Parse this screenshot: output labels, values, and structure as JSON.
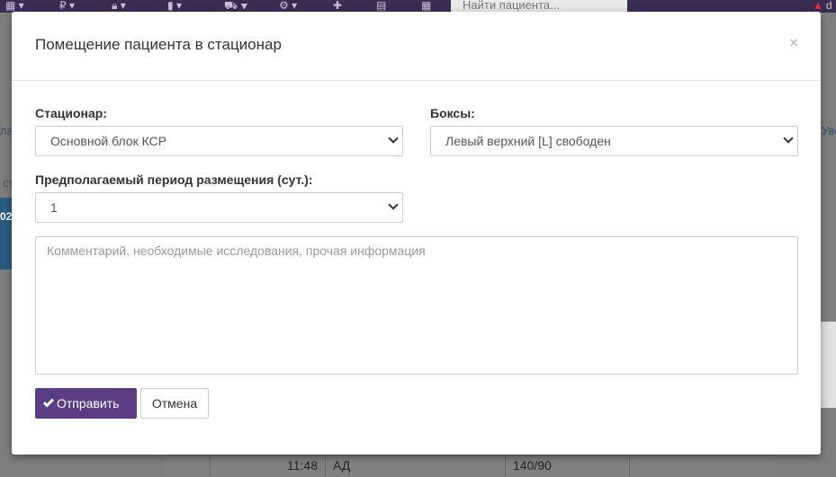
{
  "topbar": {
    "search_placeholder": "Найти пациента...",
    "alert_text": "d"
  },
  "background": {
    "left_strip_text": "02",
    "left_text_1": "ла",
    "left_text_2": "ст",
    "right_text": "Уве",
    "row": {
      "time": "11:48",
      "type": "АД",
      "value": "140/90"
    }
  },
  "modal": {
    "title": "Помещение пациента в стационар",
    "close_label": "×",
    "hospital": {
      "label": "Стационар:",
      "value": "Основной блок КСР"
    },
    "boxes": {
      "label": "Боксы:",
      "value": "Левый верхний [L] свободен"
    },
    "period": {
      "label": "Предполагаемый период размещения (сут.):",
      "value": "1"
    },
    "comment_placeholder": "Комментарий, необходимые исследования, прочая информация",
    "submit_label": "Отправить",
    "cancel_label": "Отмена"
  },
  "colors": {
    "brand": "#5b3d85",
    "topbar": "#3b2c52"
  }
}
